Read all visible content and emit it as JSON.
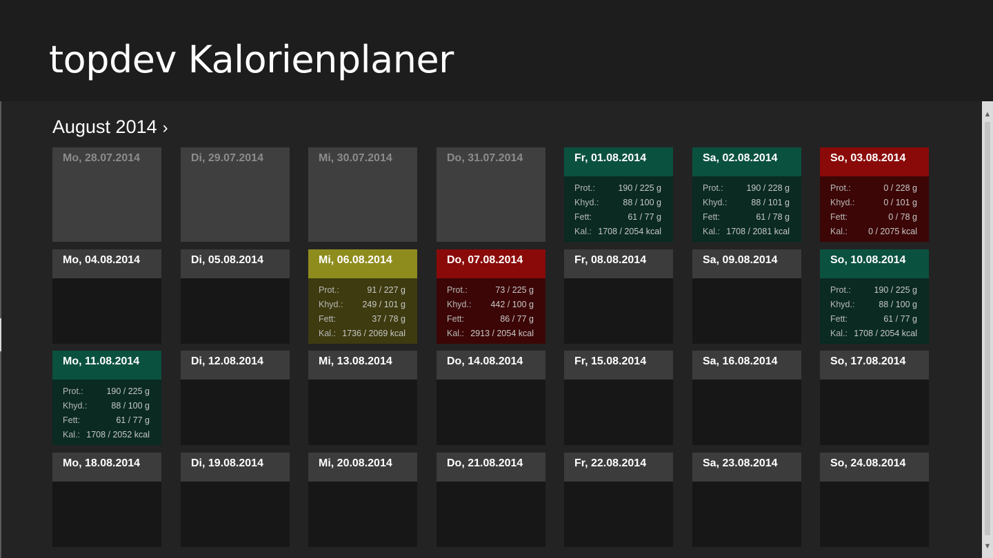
{
  "app": {
    "title": "topdev Kalorienplaner"
  },
  "calendar": {
    "month_label": "August 2014",
    "chevron": "›",
    "labels": {
      "protein": "Prot.:",
      "carbs": "Khyd.:",
      "fat": "Fett:",
      "calories": "Kal.:"
    },
    "days": [
      {
        "date": "Mo, 28.07.2014",
        "status": "prev"
      },
      {
        "date": "Di, 29.07.2014",
        "status": "prev"
      },
      {
        "date": "Mi, 30.07.2014",
        "status": "prev"
      },
      {
        "date": "Do, 31.07.2014",
        "status": "prev"
      },
      {
        "date": "Fr, 01.08.2014",
        "status": "green",
        "protein": "190 / 225 g",
        "carbs": "88 / 100 g",
        "fat": "61 / 77 g",
        "calories": "1708 / 2054 kcal"
      },
      {
        "date": "Sa, 02.08.2014",
        "status": "green",
        "protein": "190 / 228 g",
        "carbs": "88 / 101 g",
        "fat": "61 / 78 g",
        "calories": "1708 / 2081 kcal"
      },
      {
        "date": "So, 03.08.2014",
        "status": "red",
        "protein": "0 / 228 g",
        "carbs": "0 / 101 g",
        "fat": "0 / 78 g",
        "calories": "0 / 2075 kcal"
      },
      {
        "date": "Mo, 04.08.2014",
        "status": "empty"
      },
      {
        "date": "Di, 05.08.2014",
        "status": "empty"
      },
      {
        "date": "Mi, 06.08.2014",
        "status": "olive",
        "protein": "91 / 227 g",
        "carbs": "249 / 101 g",
        "fat": "37 / 78 g",
        "calories": "1736 / 2069 kcal"
      },
      {
        "date": "Do, 07.08.2014",
        "status": "red",
        "protein": "73 / 225 g",
        "carbs": "442 / 100 g",
        "fat": "86 / 77 g",
        "calories": "2913 / 2054 kcal"
      },
      {
        "date": "Fr, 08.08.2014",
        "status": "empty"
      },
      {
        "date": "Sa, 09.08.2014",
        "status": "empty"
      },
      {
        "date": "So, 10.08.2014",
        "status": "green",
        "protein": "190 / 225 g",
        "carbs": "88 / 100 g",
        "fat": "61 / 77 g",
        "calories": "1708 / 2054 kcal"
      },
      {
        "date": "Mo, 11.08.2014",
        "status": "green",
        "protein": "190 / 225 g",
        "carbs": "88 / 100 g",
        "fat": "61 / 77 g",
        "calories": "1708 / 2052 kcal"
      },
      {
        "date": "Di, 12.08.2014",
        "status": "empty"
      },
      {
        "date": "Mi, 13.08.2014",
        "status": "empty"
      },
      {
        "date": "Do, 14.08.2014",
        "status": "empty"
      },
      {
        "date": "Fr, 15.08.2014",
        "status": "empty"
      },
      {
        "date": "Sa, 16.08.2014",
        "status": "empty"
      },
      {
        "date": "So, 17.08.2014",
        "status": "empty"
      },
      {
        "date": "Mo, 18.08.2014",
        "status": "empty"
      },
      {
        "date": "Di, 19.08.2014",
        "status": "empty"
      },
      {
        "date": "Mi, 20.08.2014",
        "status": "empty"
      },
      {
        "date": "Do, 21.08.2014",
        "status": "empty"
      },
      {
        "date": "Fr, 22.08.2014",
        "status": "empty"
      },
      {
        "date": "Sa, 23.08.2014",
        "status": "empty"
      },
      {
        "date": "So, 24.08.2014",
        "status": "empty"
      }
    ]
  },
  "scrollbar": {
    "up_icon": "up-arrow-icon",
    "down_icon": "down-arrow-icon"
  },
  "colors": {
    "background": "#1d1d1d",
    "on_target": "#0b5140",
    "over_target": "#8a0a0a",
    "warning": "#8f8c1e",
    "tile_header": "#3c3c3c"
  }
}
